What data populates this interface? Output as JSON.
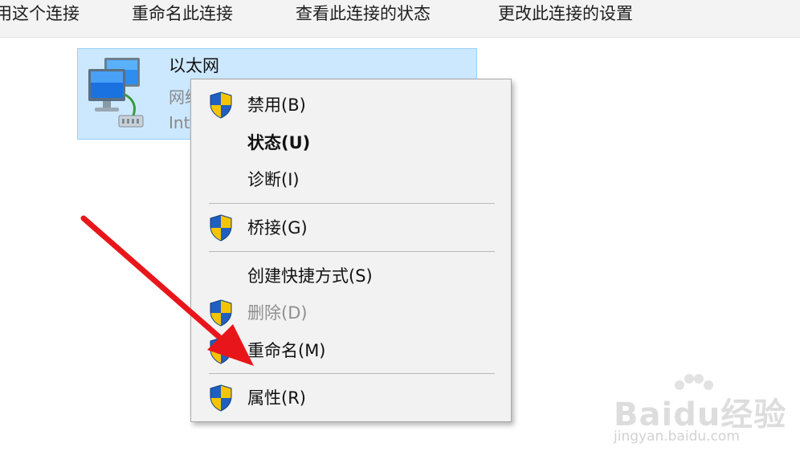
{
  "toolbar": {
    "items": [
      "用这个连接",
      "重命名此连接",
      "查看此连接的状态",
      "更改此连接的设置"
    ]
  },
  "connection": {
    "name": "以太网",
    "line2": "网络",
    "line3": "Intel",
    "icon": "network-adapter-icon"
  },
  "menu": {
    "items": [
      {
        "label": "禁用(B)",
        "icon": "uac-shield-icon"
      },
      {
        "label": "状态(U)",
        "icon": ""
      },
      {
        "label": "诊断(I)",
        "icon": ""
      },
      {
        "label": "桥接(G)",
        "icon": "uac-shield-icon"
      },
      {
        "label": "创建快捷方式(S)",
        "icon": ""
      },
      {
        "label": "删除(D)",
        "icon": "uac-shield-icon",
        "disabled": true
      },
      {
        "label": "重命名(M)",
        "icon": "uac-shield-icon"
      },
      {
        "label": "属性(R)",
        "icon": "uac-shield-icon"
      }
    ]
  },
  "annotation": {
    "arrow_color": "#e8161b"
  },
  "watermark": {
    "brand": "Baidu经验",
    "url": "jingyan.baidu.com"
  },
  "colors": {
    "selection_bg": "#cce8ff",
    "selection_border": "#99d1ff",
    "menu_bg": "#f2f2f2",
    "shield_blue": "#1f5fbf",
    "shield_yellow": "#f5c400"
  }
}
